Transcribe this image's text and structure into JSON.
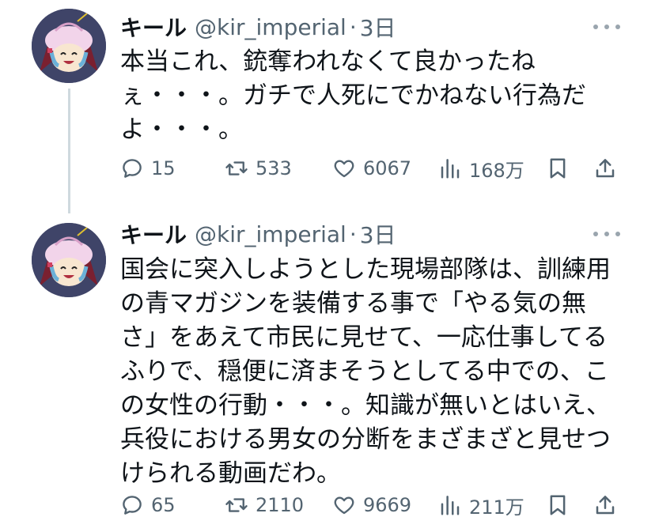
{
  "tweets": [
    {
      "author_name": "キール",
      "author_handle": "@kir_imperial",
      "separator": "·",
      "time": "3日",
      "text_lines": [
        "本当これ、銃奪われなくて良かったね",
        "ぇ・・・。ガチで人死にでかねない行為だ",
        "よ・・・。"
      ],
      "stats": {
        "replies": "15",
        "retweets": "533",
        "likes": "6067",
        "views": "168万"
      }
    },
    {
      "author_name": "キール",
      "author_handle": "@kir_imperial",
      "separator": "·",
      "time": "3日",
      "text_lines": [
        "国会に突入しようとした現場部隊は、訓練用",
        "の青マガジンを装備する事で「やる気の無",
        "さ」をあえて市民に見せて、一応仕事してる",
        "ふりで、穏便に済まそうとしてる中での、こ",
        "の女性の行動・・・。知識が無いとはいえ、",
        "兵役における男女の分断をまざまざと見せつ",
        "けられる動画だわ。"
      ],
      "stats": {
        "replies": "65",
        "retweets": "2110",
        "likes": "9669",
        "views": "211万"
      }
    }
  ],
  "colors": {
    "text_primary": "#0f1419",
    "text_secondary": "#536471",
    "thread_line": "#cfd9de",
    "avatar_bg": "#3f4468"
  },
  "icons": {
    "reply": "speech-bubble-icon",
    "retweet": "retweet-arrows-icon",
    "like": "heart-icon",
    "views": "bar-chart-icon",
    "bookmark": "bookmark-icon",
    "share": "share-upload-icon",
    "more": "more-dots-icon"
  }
}
